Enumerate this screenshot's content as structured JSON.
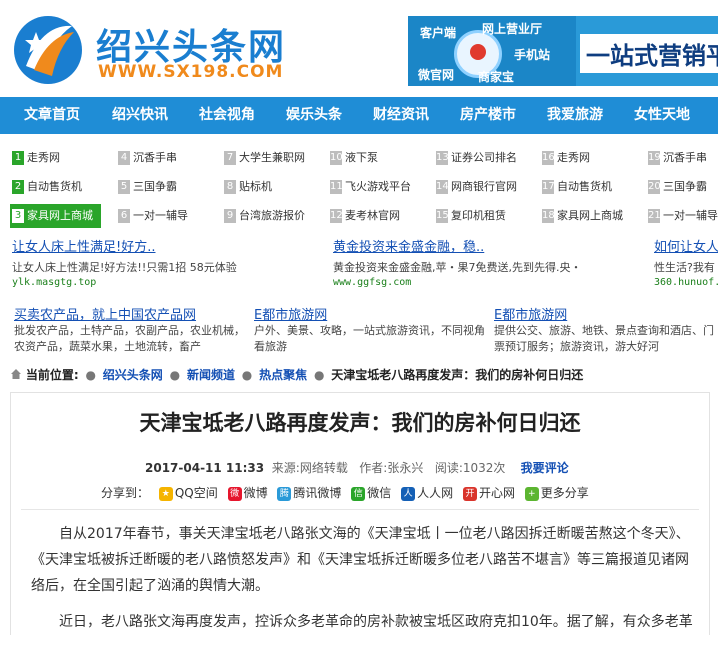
{
  "header": {
    "logo_title": "绍兴头条网",
    "logo_url": "WWW.SX198.COM",
    "banner": {
      "tags": [
        "客户端",
        "网上营业厅",
        "手机站",
        "微官网",
        "商家宝"
      ],
      "slogan": "一站式营销平"
    }
  },
  "nav": {
    "items": [
      "文章首页",
      "绍兴快讯",
      "社会视角",
      "娱乐头条",
      "财经资讯",
      "房产楼市",
      "我爱旅游",
      "女性天地"
    ]
  },
  "grid": {
    "cols": [
      [
        {
          "n": "1",
          "label": "走秀网"
        },
        {
          "n": "2",
          "label": "自动售货机"
        },
        {
          "n": "3",
          "label": "家具网上商城"
        }
      ],
      [
        {
          "n": "4",
          "label": "沉香手串"
        },
        {
          "n": "5",
          "label": "三国争霸"
        },
        {
          "n": "6",
          "label": "一对一辅导"
        }
      ],
      [
        {
          "n": "7",
          "label": "大学生兼职网"
        },
        {
          "n": "8",
          "label": "贴标机"
        },
        {
          "n": "9",
          "label": "台湾旅游报价"
        }
      ],
      [
        {
          "n": "10",
          "label": "液下泵"
        },
        {
          "n": "11",
          "label": "飞火游戏平台"
        },
        {
          "n": "12",
          "label": "麦考林官网"
        }
      ],
      [
        {
          "n": "13",
          "label": "证券公司排名"
        },
        {
          "n": "14",
          "label": "网商银行官网"
        },
        {
          "n": "15",
          "label": "复印机租赁"
        }
      ],
      [
        {
          "n": "16",
          "label": "走秀网"
        },
        {
          "n": "17",
          "label": "自动售货机"
        },
        {
          "n": "18",
          "label": "家具网上商城"
        }
      ],
      [
        {
          "n": "19",
          "label": "沉香手串"
        },
        {
          "n": "20",
          "label": "三国争霸"
        },
        {
          "n": "21",
          "label": "一对一辅导"
        }
      ]
    ]
  },
  "ads_row1": [
    {
      "title": "让女人床上性满足!好方..",
      "desc": "让女人床上性满足!好方法!!只需1招 58元体验",
      "url": "ylk.masgtg.top"
    },
    {
      "title": "黄金投资来金盛金融，稳..",
      "desc": "黄金投资来金盛金融,苹・果7免费送,先到先得.央・",
      "url": "www.ggfsg.com"
    },
    {
      "title": "如何让女人",
      "desc": "性生活?我有",
      "url": "360.hunuof."
    }
  ],
  "ads_row2": [
    {
      "title": "买卖农产品，就上中国农产品网",
      "desc": "批发农产品，土特产品，农副产品，农业机械，农资产品，蔬菜水果，土地流转，畜产"
    },
    {
      "title": "E都市旅游网",
      "desc": "户外、美景、攻略，一站式旅游资讯，不同视角看旅游"
    },
    {
      "title": "E都市旅游网",
      "desc": "提供公交、旅游、地铁、景点查询和酒店、门票预订服务；旅游资讯，游大好河"
    }
  ],
  "breadcrumb": {
    "prefix": "当前位置:",
    "links": [
      "绍兴头条网",
      "新闻频道",
      "热点聚焦"
    ],
    "current": "天津宝坻老八路再度发声：我们的房补何日归还"
  },
  "article": {
    "title": "天津宝坻老八路再度发声：我们的房补何日归还",
    "date": "2017-04-11 11:33",
    "source_label": "来源:",
    "source": "网络转载",
    "author_label": "作者:",
    "author": "张永兴",
    "reads_label": "阅读:",
    "reads": "1032次",
    "comment": "我要评论",
    "share_label": "分享到：",
    "share_items": [
      {
        "label": "QQ空间",
        "color": "#f5b400",
        "glyph": "★"
      },
      {
        "label": "微博",
        "color": "#e6162d",
        "glyph": "微"
      },
      {
        "label": "腾讯微博",
        "color": "#2a9ad8",
        "glyph": "腾"
      },
      {
        "label": "微信",
        "color": "#2aa52a",
        "glyph": "信"
      },
      {
        "label": "人人网",
        "color": "#1560b6",
        "glyph": "人"
      },
      {
        "label": "开心网",
        "color": "#d9342b",
        "glyph": "开"
      },
      {
        "label": "更多分享",
        "color": "#5cb531",
        "glyph": "+"
      }
    ],
    "paragraphs": [
      "自从2017年春节，事关天津宝坻老八路张文海的《天津宝坻丨一位老八路因拆迁断暖苦熬这个冬天》、《天津宝坻被拆迁断暖的老八路愤怒发声》和《天津宝坻拆迁断暖多位老八路苦不堪言》等三篇报道见诸网络后，在全国引起了汹涌的舆情大潮。",
      "近日，老八路张文海再度发声，控诉众多老革命的房补款被宝坻区政府克扣10年。据了解，有众多老革"
    ]
  }
}
